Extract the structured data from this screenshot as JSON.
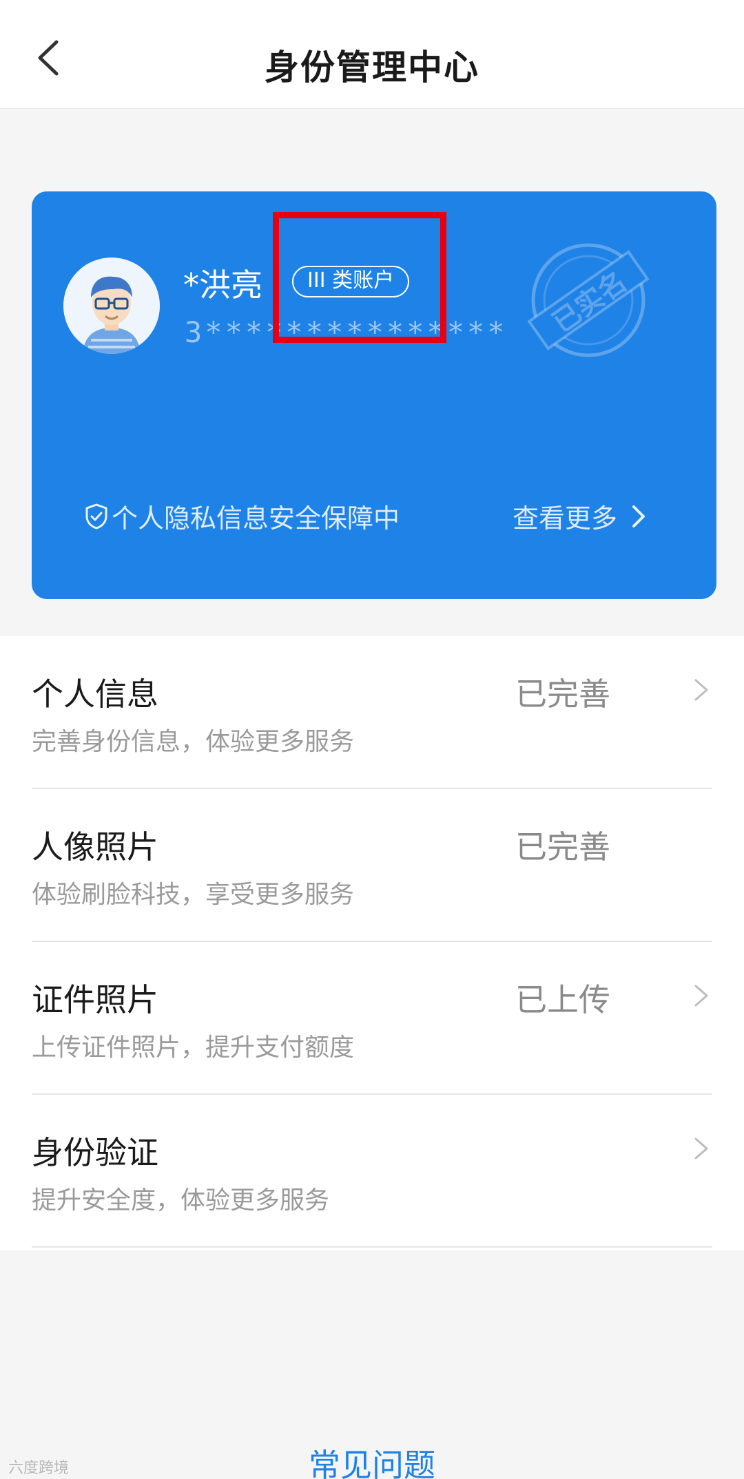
{
  "header": {
    "title": "身份管理中心"
  },
  "card": {
    "user_name": "*洪亮",
    "account_type": "III 类账户",
    "account_number": "3***************",
    "stamp_text": "已实名",
    "privacy_text": "个人隐私信息安全保障中",
    "more_label": "查看更多",
    "color": "#1f82e6"
  },
  "list": {
    "items": [
      {
        "title": "个人信息",
        "subtitle": "完善身份信息，体验更多服务",
        "status": "已完善"
      },
      {
        "title": "人像照片",
        "subtitle": "体验刷脸科技，享受更多服务",
        "status": "已完善"
      },
      {
        "title": "证件照片",
        "subtitle": "上传证件照片，提升支付额度",
        "status": "已上传"
      },
      {
        "title": "身份验证",
        "subtitle": "提升安全度，体验更多服务",
        "status": ""
      }
    ]
  },
  "footer": {
    "faq_label": "常见问题"
  },
  "watermark": {
    "text": "六度跨境"
  },
  "icons": {
    "back": "back-arrow-icon",
    "shield": "shield-check-icon",
    "chevron": "chevron-right-icon",
    "avatar": "avatar-icon"
  }
}
